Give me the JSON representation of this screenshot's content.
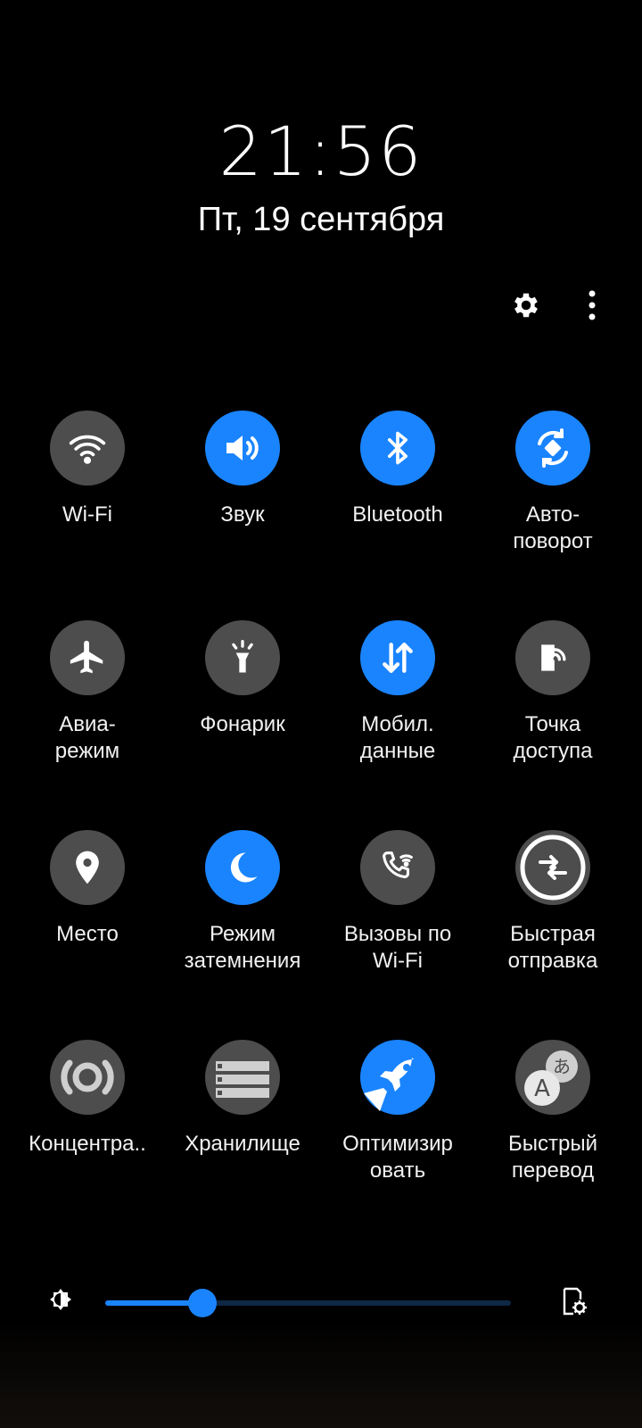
{
  "header": {
    "time": "21:56",
    "date": "Пт, 19 сентября"
  },
  "icons": {
    "settings": "gear-icon",
    "more": "more-vertical-icon"
  },
  "tiles": [
    {
      "label": "Wi-Fi",
      "icon": "wifi-icon",
      "active": false
    },
    {
      "label": "Звук",
      "icon": "sound-icon",
      "active": true
    },
    {
      "label": "Bluetooth",
      "icon": "bluetooth-icon",
      "active": true
    },
    {
      "label": "Авто-\nповорот",
      "icon": "auto-rotate-icon",
      "active": true
    },
    {
      "label": "Авиа-\nрежим",
      "icon": "airplane-icon",
      "active": false
    },
    {
      "label": "Фонарик",
      "icon": "flashlight-icon",
      "active": false
    },
    {
      "label": "Мобил.\nданные",
      "icon": "mobile-data-icon",
      "active": true
    },
    {
      "label": "Точка\nдоступа",
      "icon": "hotspot-icon",
      "active": false
    },
    {
      "label": "Место",
      "icon": "location-icon",
      "active": false
    },
    {
      "label": "Режим\nзатемнения",
      "icon": "dark-mode-icon",
      "active": true
    },
    {
      "label": "Вызовы по\nWi-Fi",
      "icon": "wifi-calling-icon",
      "active": false
    },
    {
      "label": "Быстрая\nотправка",
      "icon": "quick-share-icon",
      "active": false
    },
    {
      "label": "Концентра..",
      "icon": "focus-icon",
      "active": false
    },
    {
      "label": "Хранилище",
      "icon": "storage-icon",
      "active": false
    },
    {
      "label": "Оптимизир\nовать",
      "icon": "optimize-rocket-icon",
      "active": true
    },
    {
      "label": "Быстрый\nперевод",
      "icon": "translate-icon",
      "active": false
    }
  ],
  "brightness": {
    "level": 0.24
  },
  "colors": {
    "accent": "#1a84ff",
    "tile_off": "#4d4d4d",
    "background": "#000000"
  }
}
